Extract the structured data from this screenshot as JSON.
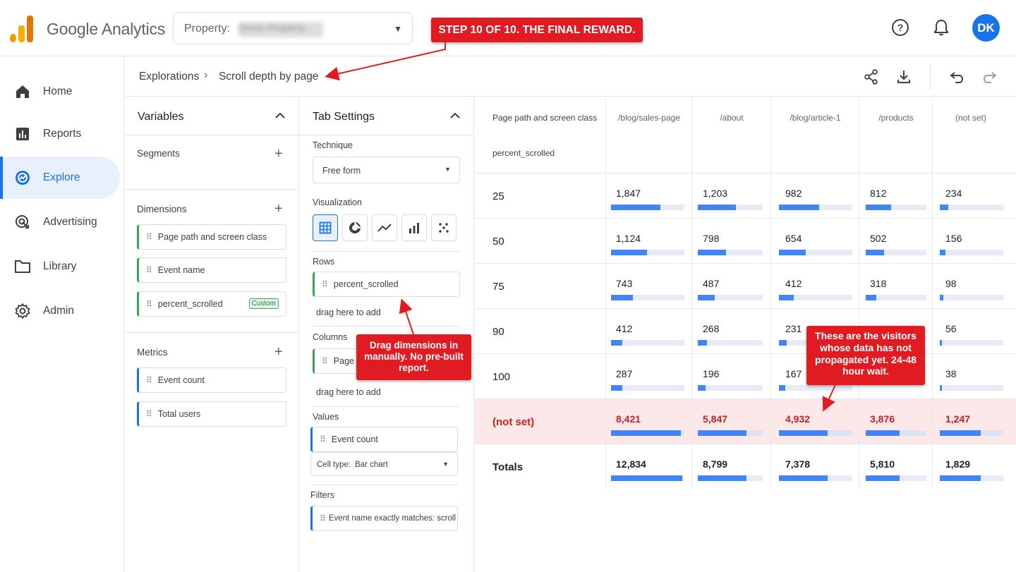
{
  "topbar": {
    "app_title": "Google Analytics",
    "property_label": "Property:",
    "property_value": "Demo Property",
    "avatar_initials": "DK"
  },
  "annotations": {
    "step": "STEP 10 OF 10. THE FINAL REWARD.",
    "drag": "Drag dimensions in manually. No pre-built report.",
    "notset": "These are the visitors whose data has not propagated yet. 24-48 hour wait."
  },
  "nav": {
    "items": [
      {
        "label": "Home",
        "icon": "home-icon"
      },
      {
        "label": "Reports",
        "icon": "reports-icon"
      },
      {
        "label": "Explore",
        "icon": "explore-icon",
        "active": true
      },
      {
        "label": "Advertising",
        "icon": "advertising-icon"
      },
      {
        "label": "Library",
        "icon": "folder-icon"
      },
      {
        "label": "Admin",
        "icon": "gear-icon"
      }
    ]
  },
  "breadcrumb": {
    "parent": "Explorations",
    "current": "Scroll depth by page"
  },
  "variables": {
    "title": "Variables",
    "segments_label": "Segments",
    "dimensions_label": "Dimensions",
    "dimensions": [
      "Page path and screen class",
      "Event name",
      "percent_scrolled"
    ],
    "custom_badge": "Custom",
    "metrics_label": "Metrics",
    "metrics": [
      "Event count",
      "Total users"
    ]
  },
  "tab_settings": {
    "title": "Tab Settings",
    "technique_label": "Technique",
    "technique_value": "Free form",
    "visualization_label": "Visualization",
    "rows_label": "Rows",
    "rows_chip": "percent_scrolled",
    "drag_here": "drag here to add",
    "columns_label": "Columns",
    "columns_chip": "Page path and screen class",
    "values_label": "Values",
    "values_chip": "Event count",
    "cell_type_label": "Cell type:",
    "cell_type_value": "Bar chart",
    "filters_label": "Filters",
    "filter_chip": "Event name exactly matches: scroll"
  },
  "table": {
    "dim_col_header": "Page path and screen class",
    "dim_row_header": "percent_scrolled",
    "columns": [
      "/blog/sales-page",
      "/about",
      "/blog/article-1",
      "/products",
      "(not set)"
    ],
    "rows": [
      {
        "label": "25",
        "values": [
          "1,847",
          "1,203",
          "982",
          "812",
          "234"
        ],
        "fills": [
          0.67,
          0.59,
          0.55,
          0.42,
          0.13
        ]
      },
      {
        "label": "50",
        "values": [
          "1,124",
          "798",
          "654",
          "502",
          "156"
        ],
        "fills": [
          0.49,
          0.43,
          0.37,
          0.3,
          0.09
        ]
      },
      {
        "label": "75",
        "values": [
          "743",
          "487",
          "412",
          "318",
          "98"
        ],
        "fills": [
          0.3,
          0.26,
          0.2,
          0.17,
          0.05
        ]
      },
      {
        "label": "90",
        "values": [
          "412",
          "268",
          "231",
          "",
          "56"
        ],
        "fills": [
          0.15,
          0.14,
          0.11,
          0.0,
          0.03
        ]
      },
      {
        "label": "100",
        "values": [
          "287",
          "196",
          "167",
          "",
          "38"
        ],
        "fills": [
          0.15,
          0.12,
          0.09,
          0.0,
          0.03
        ]
      },
      {
        "label": "(not set)",
        "values": [
          "8,421",
          "5,847",
          "4,932",
          "3,876",
          "1,247"
        ],
        "fills": [
          0.95,
          0.75,
          0.66,
          0.56,
          0.64
        ],
        "highlight": true
      },
      {
        "label": "Totals",
        "values": [
          "12,834",
          "8,799",
          "7,378",
          "5,810",
          "1,829"
        ],
        "fills": [
          0.97,
          0.75,
          0.66,
          0.56,
          0.64
        ],
        "totals": true
      }
    ]
  },
  "colors": {
    "accent": "#1a73e8",
    "bar": "#4285f4",
    "alert_red": "#e11b22",
    "notset_bg": "#fce8e8"
  }
}
